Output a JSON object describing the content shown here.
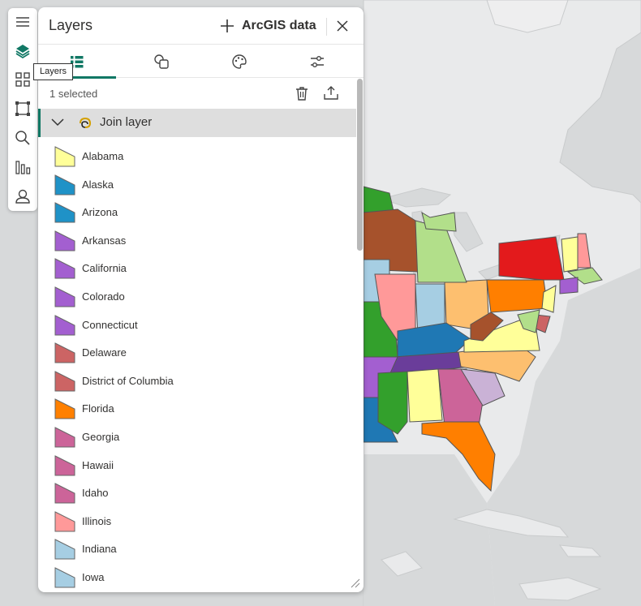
{
  "colors": {
    "accent": "#117865",
    "water": "#d7d9da",
    "land": "#e9eaeb"
  },
  "tool_rail": {
    "items": [
      "menu-icon",
      "layers-icon",
      "legend-icon",
      "select-icon",
      "search-icon",
      "chart-icon",
      "account-icon"
    ],
    "tooltip": "Layers"
  },
  "panel": {
    "title": "Layers",
    "add_data_label": "ArcGIS data",
    "tabs": [
      "layers-list-icon",
      "shapes-icon",
      "palette-icon",
      "sliders-icon"
    ],
    "selected_text": "1 selected",
    "group": {
      "label": "Join layer",
      "expanded": true
    },
    "legend": [
      {
        "label": "Alabama",
        "color": "#ffff99"
      },
      {
        "label": "Alaska",
        "color": "#1f92c7"
      },
      {
        "label": "Arizona",
        "color": "#1f92c7"
      },
      {
        "label": "Arkansas",
        "color": "#a35fd0"
      },
      {
        "label": "California",
        "color": "#a35fd0"
      },
      {
        "label": "Colorado",
        "color": "#a35fd0"
      },
      {
        "label": "Connecticut",
        "color": "#a35fd0"
      },
      {
        "label": "Delaware",
        "color": "#cc6464"
      },
      {
        "label": "District of Columbia",
        "color": "#cc6464"
      },
      {
        "label": "Florida",
        "color": "#ff8000"
      },
      {
        "label": "Georgia",
        "color": "#cc6499"
      },
      {
        "label": "Hawaii",
        "color": "#cc6499"
      },
      {
        "label": "Idaho",
        "color": "#cc6499"
      },
      {
        "label": "Illinois",
        "color": "#ff9999"
      },
      {
        "label": "Indiana",
        "color": "#a6cee3"
      },
      {
        "label": "Iowa",
        "color": "#a6cee3"
      }
    ]
  }
}
